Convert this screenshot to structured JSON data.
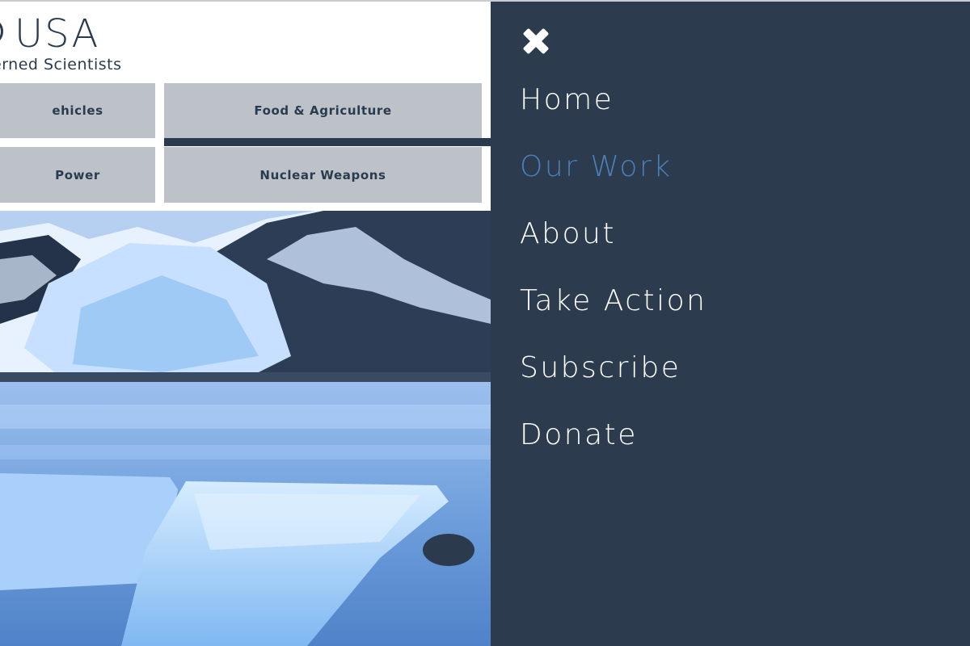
{
  "logo": {
    "wordmark": "USA",
    "tagline": "erned Scientists"
  },
  "tiles": [
    {
      "label": "ehicles"
    },
    {
      "label": "Food & Agriculture"
    },
    {
      "label": "Power"
    },
    {
      "label": "Nuclear Weapons"
    }
  ],
  "menu": {
    "close_icon": "close-icon",
    "items": [
      {
        "label": "Home"
      },
      {
        "label": "Our Work",
        "current": true
      },
      {
        "label": "About"
      },
      {
        "label": "Take Action"
      },
      {
        "label": "Subscribe"
      },
      {
        "label": "Donate"
      }
    ]
  },
  "colors": {
    "drawer_bg": "#2c3b4e",
    "menu_text": "#ffffff",
    "menu_current": "#4b7fb5",
    "tile_bg": "#bcc2c7",
    "brand_text": "#2b3b4f"
  }
}
